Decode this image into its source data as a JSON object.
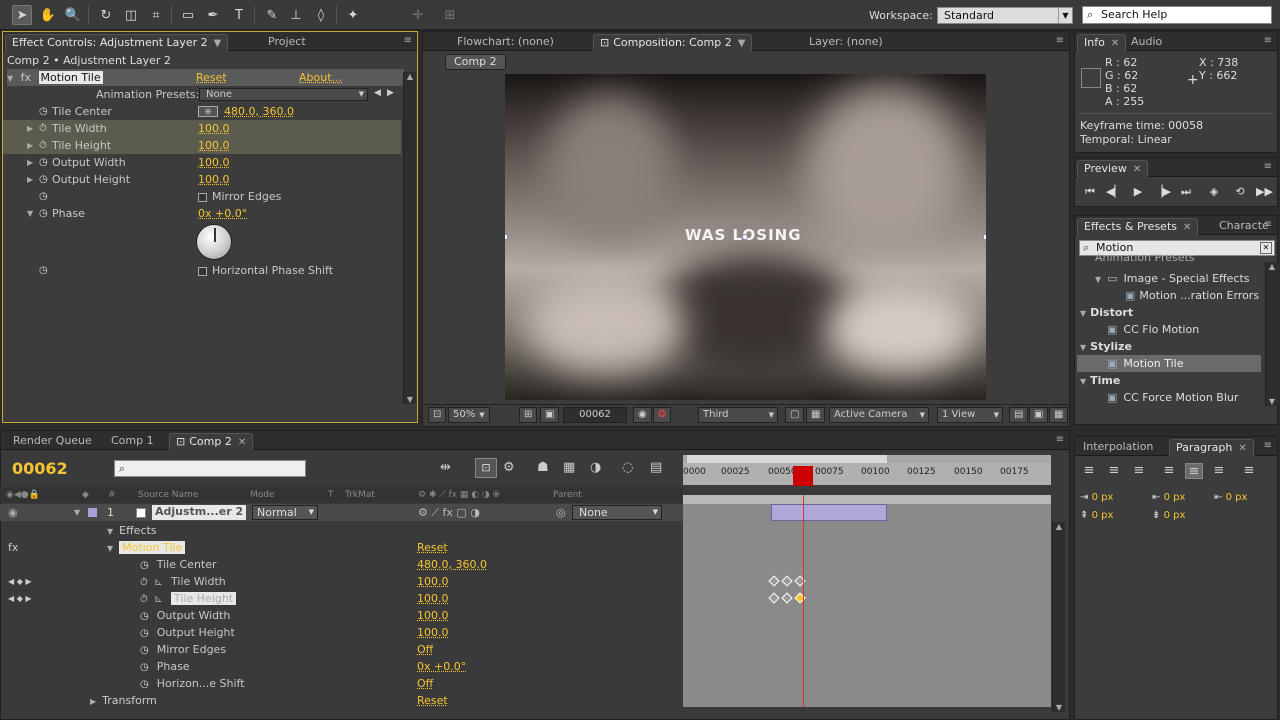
{
  "toolbar": {
    "tools": [
      {
        "icon": "selection-arrow-icon",
        "glyph": "➤"
      },
      {
        "icon": "hand-icon",
        "glyph": "✋"
      },
      {
        "icon": "zoom-icon",
        "glyph": "🔍"
      },
      {
        "icon": "rotate-icon",
        "glyph": "↻"
      },
      {
        "icon": "camera-orbit-icon",
        "glyph": "◫"
      },
      {
        "icon": "pan-behind-icon",
        "glyph": "⌗"
      },
      {
        "icon": "rectangle-mask-icon",
        "glyph": "▭"
      },
      {
        "icon": "pen-icon",
        "glyph": "✒"
      },
      {
        "icon": "type-icon",
        "glyph": "T"
      },
      {
        "icon": "brush-icon",
        "glyph": "✎"
      },
      {
        "icon": "clone-stamp-icon",
        "glyph": "⊥"
      },
      {
        "icon": "eraser-icon",
        "glyph": "◊"
      },
      {
        "icon": "puppet-pin-icon",
        "glyph": "✦"
      }
    ],
    "workspace_label": "Workspace:",
    "workspace_value": "Standard",
    "search_placeholder": "Search Help"
  },
  "effect_controls": {
    "tab_active": "Effect Controls: Adjustment Layer 2",
    "tab_project": "Project",
    "breadcrumb": "Comp 2 • Adjustment Layer 2",
    "effect_name": "Motion Tile",
    "reset": "Reset",
    "about": "About...",
    "animation_presets_label": "Animation Presets:",
    "animation_presets_value": "None",
    "props": [
      {
        "label": "Tile Center",
        "value": "480.0, 360.0"
      },
      {
        "label": "Tile Width",
        "value": "100.0"
      },
      {
        "label": "Tile Height",
        "value": "100.0"
      },
      {
        "label": "Output Width",
        "value": "100.0"
      },
      {
        "label": "Output Height",
        "value": "100.0"
      },
      {
        "label": "Mirror Edges",
        "value": ""
      },
      {
        "label": "Phase",
        "value": "0x +0.0°"
      },
      {
        "label": "Horizontal Phase Shift",
        "value": ""
      }
    ],
    "mirror_edges_label": "Mirror Edges",
    "hps_label": "Horizontal Phase Shift"
  },
  "viewer": {
    "tabs": [
      "Flowchart: (none)",
      "Composition: Comp 2",
      "Layer: (none)"
    ],
    "comp_label": "Comp 2",
    "overlay_text": "WAS LOSING",
    "zoom": "50%",
    "timecode": "00062",
    "resolution": "Third",
    "camera": "Active Camera",
    "views": "1 View"
  },
  "info": {
    "tabs": [
      "Info",
      "Audio"
    ],
    "r": "R : 62",
    "g": "G : 62",
    "b": "B : 62",
    "a": "A : 255",
    "x": "X : 738",
    "y": "Y : 662",
    "keyframe_time": "Keyframe time: 00058",
    "temporal": "Temporal: Linear"
  },
  "preview": {
    "tab": "Preview"
  },
  "effects_presets": {
    "tabs": [
      "Effects & Presets",
      "Characte"
    ],
    "search_value": "Motion",
    "items": [
      {
        "label": "Animation Presets",
        "kind": "cut"
      },
      {
        "label": "Image - Special Effects",
        "kind": "folder"
      },
      {
        "label": "Motion ...ration Errors",
        "kind": "preset"
      },
      {
        "label": "Distort",
        "kind": "cat"
      },
      {
        "label": "CC Flo Motion",
        "kind": "effect"
      },
      {
        "label": "Stylize",
        "kind": "cat"
      },
      {
        "label": "Motion Tile",
        "kind": "effect-sel"
      },
      {
        "label": "Time",
        "kind": "cat"
      },
      {
        "label": "CC Force Motion Blur",
        "kind": "effect"
      }
    ]
  },
  "timeline": {
    "tabs": [
      "Render Queue",
      "Comp 1",
      "Comp 2"
    ],
    "timecode": "00062",
    "ruler": [
      "0000",
      "00025",
      "00050",
      "00075",
      "00100",
      "00125",
      "00150",
      "00175"
    ],
    "columns": {
      "source": "Source Name",
      "mode": "Mode",
      "t": "T",
      "trkmat": "TrkMat",
      "parent": "Parent"
    },
    "layer": {
      "num": "1",
      "name": "Adjustm...er 2",
      "mode": "Normal",
      "parent": "None"
    },
    "rows": [
      {
        "label": "Effects",
        "value": ""
      },
      {
        "label": "Motion Tile",
        "value": "Reset"
      },
      {
        "label": "Tile Center",
        "value": "480.0, 360.0"
      },
      {
        "label": "Tile Width",
        "value": "100.0"
      },
      {
        "label": "Tile Height",
        "value": "100.0"
      },
      {
        "label": "Output Width",
        "value": "100.0"
      },
      {
        "label": "Output Height",
        "value": "100.0"
      },
      {
        "label": "Mirror Edges",
        "value": "Off"
      },
      {
        "label": "Phase",
        "value": "0x +0.0°"
      },
      {
        "label": "Horizon...e Shift",
        "value": "Off"
      },
      {
        "label": "Transform",
        "value": "Reset"
      }
    ]
  },
  "paragraph": {
    "tabs": [
      "Interpolation",
      "Paragraph"
    ],
    "indents": [
      "0 px",
      "0 px",
      "0 px",
      "0 px",
      "0 px"
    ]
  }
}
